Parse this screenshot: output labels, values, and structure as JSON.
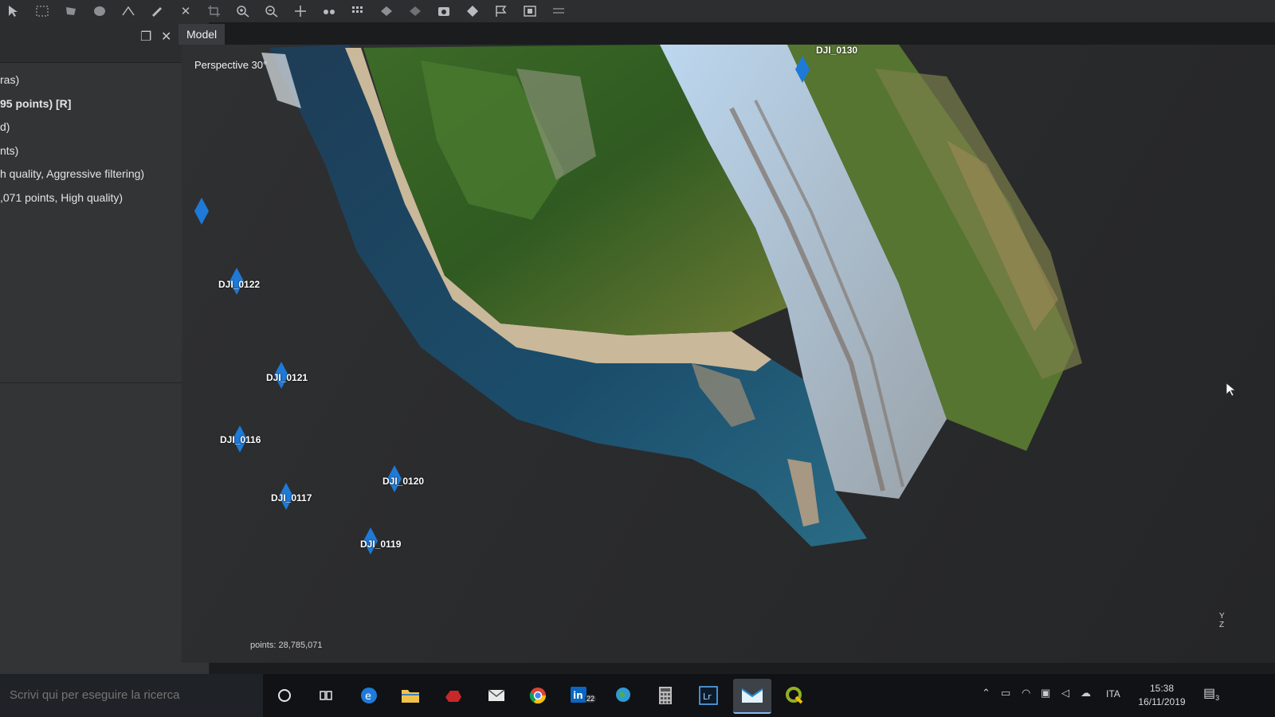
{
  "toolbar": {
    "icons": [
      "pointer-icon",
      "rect-select-icon",
      "lasso-select-icon",
      "circle-select-icon",
      "ruler-icon",
      "pencil-icon",
      "delete-icon",
      "crop-icon",
      "zoom-in-icon",
      "zoom-out-icon",
      "navigate-icon",
      "points-icon",
      "grid-icon",
      "shape-icon",
      "model-shape-icon",
      "camera-icon",
      "marker-icon",
      "flag-icon",
      "photo-icon",
      "menu-icon"
    ]
  },
  "left_panel": {
    "tree_items": [
      {
        "label": "ras)",
        "bold": false
      },
      {
        "label": "95 points) [R]",
        "bold": true
      },
      {
        "label": "d)",
        "bold": false
      },
      {
        "label": "nts)",
        "bold": false
      },
      {
        "label": "h quality, Aggressive filtering)",
        "bold": false
      },
      {
        "label": ",071 points, High quality)",
        "bold": false
      }
    ]
  },
  "model_tab": {
    "label": "Model"
  },
  "viewport": {
    "label": "Perspective 30°",
    "points": "points: 28,785,071",
    "axes": {
      "y": "Y",
      "z": "Z"
    },
    "cameras": [
      {
        "label": "DJI_0130"
      },
      {
        "label": "DJI_0122"
      },
      {
        "label": "DJI_0121"
      },
      {
        "label": "DJI_0116"
      },
      {
        "label": "DJI_0120"
      },
      {
        "label": "DJI_0117"
      },
      {
        "label": "DJI_0119"
      }
    ]
  },
  "taskbar": {
    "search_placeholder": "Scrivi qui per eseguire la ricerca",
    "linkedin_badge": "22",
    "notification_count": "3",
    "language": "ITA",
    "time": "15:38",
    "date": "16/11/2019"
  },
  "colors": {
    "camera_blue": "#1e7ad6",
    "panel": "#333436",
    "viewport": "#2b2c2e",
    "taskbar": "#101215"
  }
}
